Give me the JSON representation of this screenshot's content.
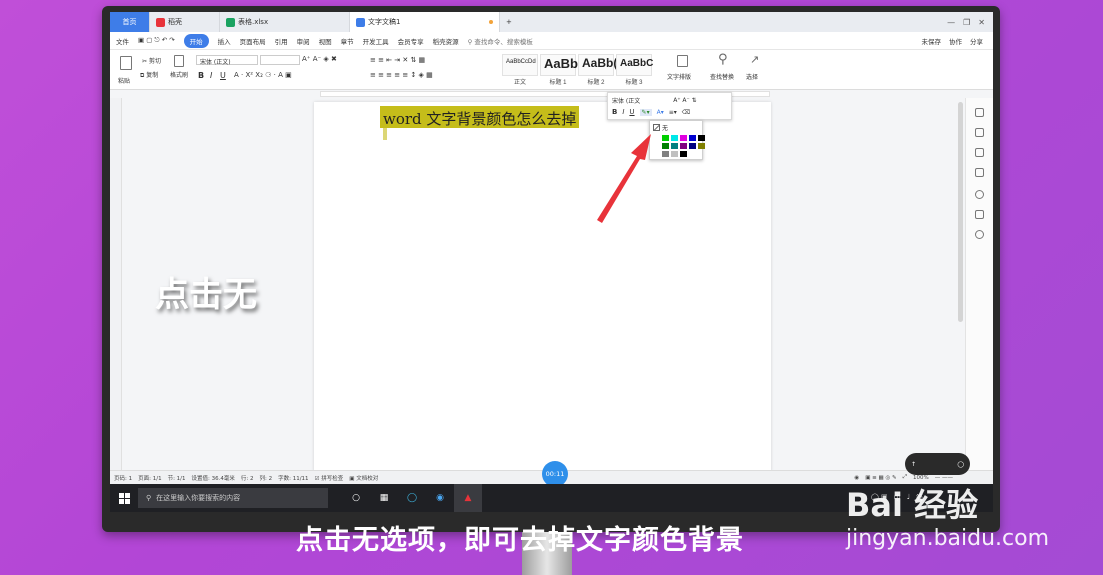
{
  "tabs": {
    "home": "首页",
    "t1": "稻壳",
    "t2": "表格.xlsx",
    "t3": "文字文稿1",
    "new": "+"
  },
  "menu": {
    "file": "文件",
    "start": "开始",
    "items": [
      "插入",
      "页面布局",
      "引用",
      "审阅",
      "视图",
      "章节",
      "开发工具",
      "会员专享",
      "稻壳资源"
    ],
    "search": "查找命令、搜索模板",
    "unsaved": "未保存",
    "collab": "协作",
    "share": "分享"
  },
  "ribbon": {
    "paste": "粘贴",
    "cut": "剪切",
    "copy": "复制",
    "format_painter": "格式刷",
    "font": "宋体 (正文)",
    "styles": [
      {
        "sample": "AaBbCcDd",
        "name": "正文"
      },
      {
        "sample": "AaBb",
        "name": "标题 1"
      },
      {
        "sample": "AaBb(",
        "name": "标题 2"
      },
      {
        "sample": "AaBbC",
        "name": "标题 3"
      }
    ],
    "text_layout": "文字排版",
    "find_replace": "查找替换",
    "select": "选择"
  },
  "document": {
    "text": "word 文字背景颜色怎么去掉"
  },
  "mini_toolbar": {
    "font": "宋体 (正文",
    "bold": "B",
    "italic": "I",
    "underline": "U"
  },
  "palette": {
    "none_label": "无",
    "colors": [
      "#00d000",
      "#00e8e8",
      "#e000e0",
      "#0000d0",
      "#000000",
      "#008000",
      "#008080",
      "#800080",
      "#000080",
      "#808000",
      "#808080",
      "#c0c0c0",
      "#000000"
    ]
  },
  "status": {
    "page_no": "页码: 1",
    "page": "页面: 1/1",
    "section": "节: 1/1",
    "setting": "设置值: 36.4毫米",
    "row": "行: 2",
    "col": "列: 2",
    "words": "字数: 11/11",
    "spell": "拼写检查",
    "proof": "文档校对",
    "zoom": "100%",
    "timer": "00:11"
  },
  "taskbar": {
    "search": "在这里输入你要搜索的内容",
    "tray_ime": "中",
    "tray_jian": "简"
  },
  "overlay": {
    "left_label": "点击无",
    "caption": "点击无选项，即可去掉文字颜色背景",
    "watermark_logo": "Bai 经验",
    "watermark_url": "jingyan.baidu.com"
  },
  "colors": {
    "accent": "#3e7de8",
    "highlight": "#c5bd1a",
    "arrow": "#e8333a",
    "background": "#b84bd6"
  }
}
